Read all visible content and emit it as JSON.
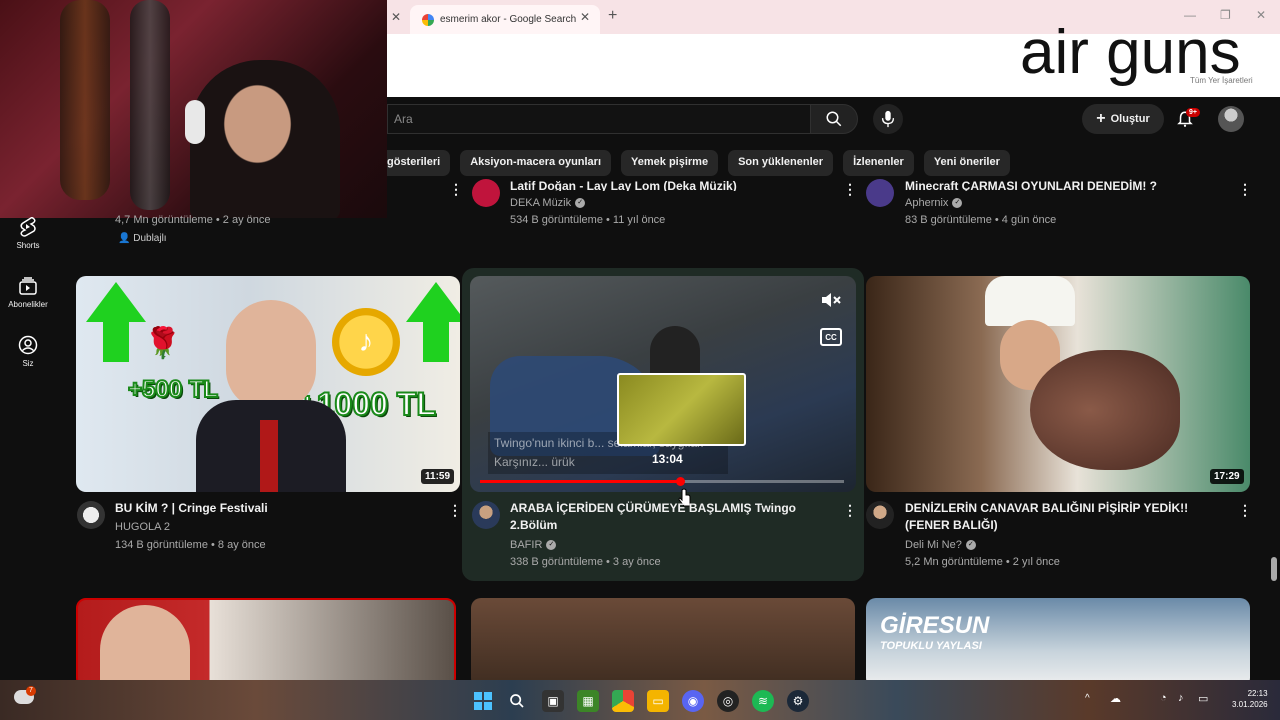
{
  "browser": {
    "active_tab_title": "esmerim akor - Google Search",
    "overlay_title": "air guns",
    "bookmark_text": "Tüm Yer İşaretleri"
  },
  "header": {
    "search_placeholder": "Ara",
    "create_label": "Oluştur",
    "notification_count": "9+"
  },
  "chips": [
    "gösterileri",
    "Aksiyon-macera oyunları",
    "Yemek pişirme",
    "Son yüklenenler",
    "İzlenenler",
    "Yeni öneriler"
  ],
  "sidebar": {
    "items": [
      {
        "label": "Shorts",
        "icon": "shorts-icon"
      },
      {
        "label": "Abonelikler",
        "icon": "subscriptions-icon"
      },
      {
        "label": "Siz",
        "icon": "you-icon"
      }
    ]
  },
  "row0": [
    {
      "meta": "4,7 Mn görüntüleme • 2 ay önce",
      "badge": "Dublajlı"
    },
    {
      "title": "Latif Doğan - Lay Lay Lom (Deka Müzik)",
      "channel": "DEKA Müzik",
      "meta": "534 B görüntüleme • 11 yıl önce"
    },
    {
      "title": "Minecraft ÇARMASI OYUNLARI DENEDİM! ?",
      "channel": "Aphernix",
      "meta": "83 B görüntüleme • 4 gün önce"
    }
  ],
  "videos": [
    {
      "title": "BU KİM ? | Cringe Festivali",
      "channel": "HUGOLA 2",
      "meta": "134 B görüntüleme • 8 ay önce",
      "duration": "11:59",
      "thumb_text_a": "+500 TL",
      "thumb_text_b": "+1000 TL"
    },
    {
      "title": "ARABA İÇERİDEN ÇÜRÜMEYE BAŞLAMIŞ Twingo 2.Bölüm",
      "channel": "BAFIR",
      "meta": "338 B görüntüleme • 3 ay önce",
      "preview_time": "13:04",
      "caption": "Twingo'nun ikinci b... selamlar, saygılar. Karşınız... ürük",
      "cc_label": "CC",
      "progress_fraction": 0.55
    },
    {
      "title": "DENİZLERİN CANAVAR BALIĞINI PİŞİRİP YEDİK!! (FENER BALIĞI)",
      "channel": "Deli Mi Ne?",
      "meta": "5,2 Mn görüntüleme • 2 yıl önce",
      "duration": "17:29"
    }
  ],
  "row2": {
    "thumb3_title": "GİRESUN",
    "thumb3_sub": "TOPUKLU YAYLASI"
  },
  "taskbar": {
    "time": "22:13",
    "date": "3.01.2026",
    "weather_badge": "7"
  },
  "colors": {
    "bg": "#0f0f0f",
    "accent_red": "#ff0000",
    "hover_card": "#1f2b25",
    "chip_bg": "#272727"
  }
}
